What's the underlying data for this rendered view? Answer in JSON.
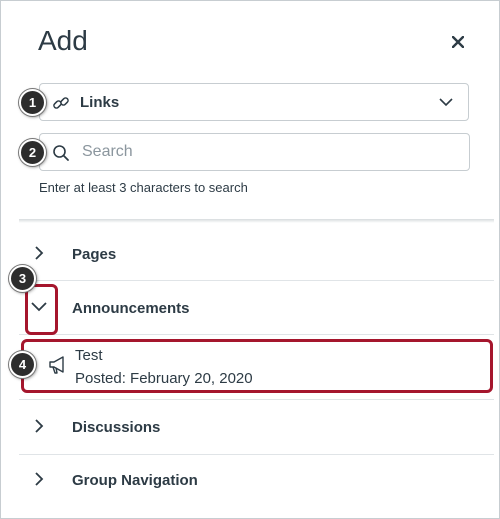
{
  "panel": {
    "title": "Add",
    "close_icon": "close-icon"
  },
  "link_type": {
    "icon": "link-icon",
    "selected": "Links",
    "dropdown_icon": "chevron-down-icon"
  },
  "search": {
    "placeholder": "Search",
    "value": "",
    "hint": "Enter at least 3 characters to search"
  },
  "sections": [
    {
      "label": "Pages",
      "expanded": false
    },
    {
      "label": "Announcements",
      "expanded": true
    },
    {
      "label": "Discussions",
      "expanded": false
    },
    {
      "label": "Group Navigation",
      "expanded": false
    }
  ],
  "announcement_item": {
    "icon": "megaphone-icon",
    "title": "Test",
    "posted": "Posted: February 20, 2020"
  },
  "callouts": [
    "1",
    "2",
    "3",
    "4"
  ],
  "colors": {
    "callout": "#a5162d",
    "text": "#2d3b45",
    "border": "#c7cdd1"
  }
}
